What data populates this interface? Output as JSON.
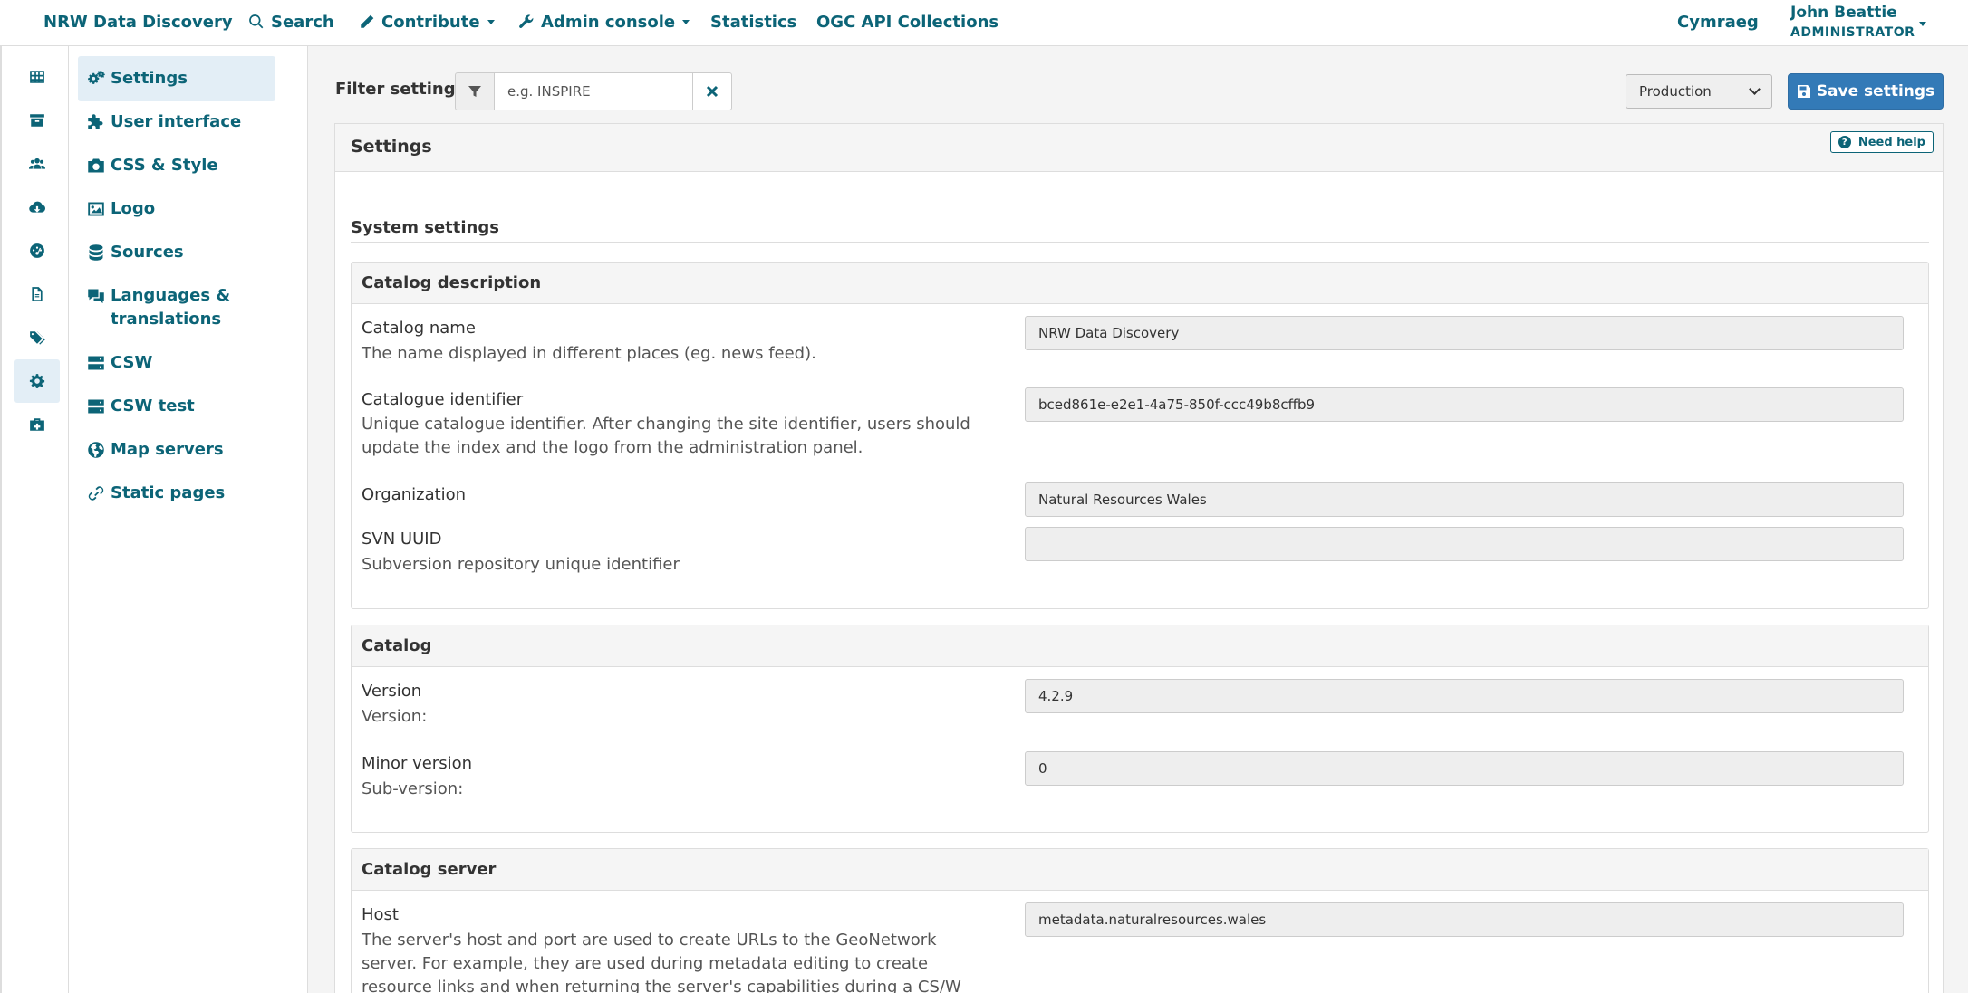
{
  "topnav": {
    "brand": "NRW Data Discovery",
    "search": "Search",
    "contribute": "Contribute",
    "admin": "Admin console",
    "statistics": "Statistics",
    "ogc": "OGC API Collections",
    "language": "Cymraeg",
    "user_name": "John Beattie",
    "user_role": "ADMINISTRATOR"
  },
  "subnav": {
    "items": [
      {
        "label": "Settings"
      },
      {
        "label": "User interface"
      },
      {
        "label": "CSS & Style"
      },
      {
        "label": "Logo"
      },
      {
        "label": "Sources"
      },
      {
        "label": "Languages & translations"
      },
      {
        "label": "CSW"
      },
      {
        "label": "CSW test"
      },
      {
        "label": "Map servers"
      },
      {
        "label": "Static pages"
      }
    ]
  },
  "filter": {
    "label": "Filter settings",
    "placeholder": "e.g. INSPIRE"
  },
  "environment": {
    "selected": "Production"
  },
  "save_label": "Save settings",
  "panel": {
    "title": "Settings",
    "help": "Need help",
    "system_title": "System settings"
  },
  "catalog_description": {
    "title": "Catalog description",
    "fields": [
      {
        "label": "Catalog name",
        "help": "The name displayed in different places (eg. news feed).",
        "value": "NRW Data Discovery"
      },
      {
        "label": "Catalogue identifier",
        "help": "Unique catalogue identifier. After changing the site identifier, users should update the index and the logo from the administration panel.",
        "value": "bced861e-e2e1-4a75-850f-ccc49b8cffb9"
      },
      {
        "label": "Organization",
        "help": "",
        "value": "Natural Resources Wales"
      },
      {
        "label": "SVN UUID",
        "help": "Subversion repository unique identifier",
        "value": ""
      }
    ]
  },
  "catalog": {
    "title": "Catalog",
    "fields": [
      {
        "label": "Version",
        "help": "Version:",
        "value": "4.2.9"
      },
      {
        "label": "Minor version",
        "help": "Sub-version:",
        "value": "0"
      }
    ]
  },
  "catalog_server": {
    "title": "Catalog server",
    "fields": [
      {
        "label": "Host",
        "help": "The server's host and port are used to create URLs to the GeoNetwork server. For example, they are used during metadata editing to create resource links and when returning the server's capabilities during a CS/W",
        "value": "metadata.naturalresources.wales"
      }
    ]
  }
}
